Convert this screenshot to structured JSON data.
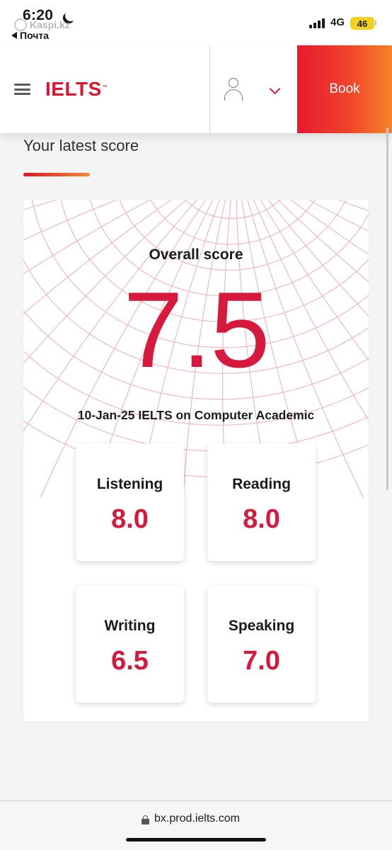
{
  "status_bar": {
    "time": "6:20",
    "back_app": "Почта",
    "overlay_app": "Kaspi.kz",
    "network": "4G",
    "battery": "46"
  },
  "header": {
    "logo": "IELTS",
    "logo_mark": "™",
    "book_label": "Book"
  },
  "section": {
    "title": "Your latest score"
  },
  "score_card": {
    "overall_label": "Overall score",
    "overall_value": "7.5",
    "test_info": "10-Jan-25 IELTS on Computer Academic",
    "bands": [
      {
        "name": "Listening",
        "score": "8.0"
      },
      {
        "name": "Reading",
        "score": "8.0"
      },
      {
        "name": "Writing",
        "score": "6.5"
      },
      {
        "name": "Speaking",
        "score": "7.0"
      }
    ]
  },
  "address_bar": {
    "url": "bx.prod.ielts.com"
  },
  "colors": {
    "brand_red": "#e4112b",
    "score_red": "#d6193d",
    "gradient_end": "#f7822a"
  }
}
